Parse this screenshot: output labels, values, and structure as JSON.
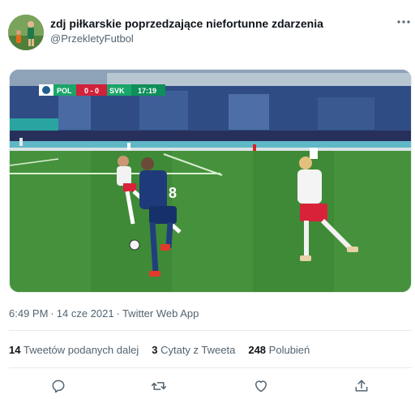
{
  "author": {
    "name": "zdj piłkarskie poprzedzające niefortunne zdarzenia",
    "handle": "@PrzekletyFutbol",
    "avatar_icon": "profile-avatar"
  },
  "menu": {
    "icon": "more-horizontal-icon"
  },
  "media": {
    "scoreboard": {
      "home_team": "POL",
      "score": "0 - 0",
      "away_team": "SVK",
      "clock": "17:19"
    },
    "player_number": "8"
  },
  "meta": {
    "time": "6:49 PM",
    "separator": "·",
    "date": "14 cze 2021",
    "app": "Twitter Web App"
  },
  "stats": {
    "retweets": {
      "count": "14",
      "label": "Tweetów podanych dalej"
    },
    "quotes": {
      "count": "3",
      "label": "Cytaty z Tweeta"
    },
    "likes": {
      "count": "248",
      "label": "Polubień"
    }
  },
  "actions": [
    {
      "icon": "reply-icon"
    },
    {
      "icon": "retweet-icon"
    },
    {
      "icon": "like-icon"
    },
    {
      "icon": "share-icon"
    }
  ],
  "colors": {
    "text_primary": "#0f1419",
    "text_secondary": "#536471",
    "divider": "#e6ecf0",
    "pitch": "#3f8a36",
    "scoreboard_green": "#1aa56a"
  }
}
